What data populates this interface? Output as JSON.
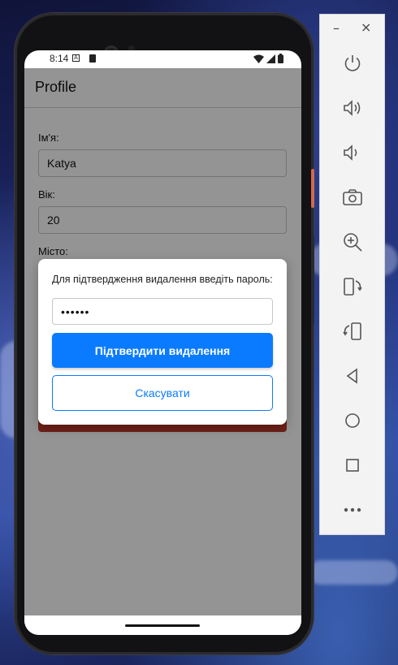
{
  "status_bar": {
    "time": "8:14"
  },
  "app": {
    "title": "Profile"
  },
  "form": {
    "name_label": "Ім'я:",
    "name_value": "Katya",
    "age_label": "Вік:",
    "age_value": "20",
    "city_label": "Місто:"
  },
  "dialog": {
    "message": "Для підтвердження видалення введіть пароль:",
    "password_value": "••••••",
    "confirm_label": "Підтвердити видалення",
    "cancel_label": "Скасувати"
  },
  "emulator_panel": {
    "minimize_label": "–",
    "close_label": "×",
    "tools": [
      {
        "icon": "power-icon"
      },
      {
        "icon": "volume-up-icon"
      },
      {
        "icon": "volume-down-icon"
      },
      {
        "icon": "camera-icon"
      },
      {
        "icon": "zoom-icon"
      },
      {
        "icon": "rotate-left-icon"
      },
      {
        "icon": "rotate-right-icon"
      },
      {
        "icon": "back-icon"
      },
      {
        "icon": "home-icon"
      },
      {
        "icon": "overview-icon"
      },
      {
        "icon": "more-icon"
      }
    ]
  },
  "colors": {
    "primary": "#0a7bff",
    "danger": "#c0392b"
  }
}
